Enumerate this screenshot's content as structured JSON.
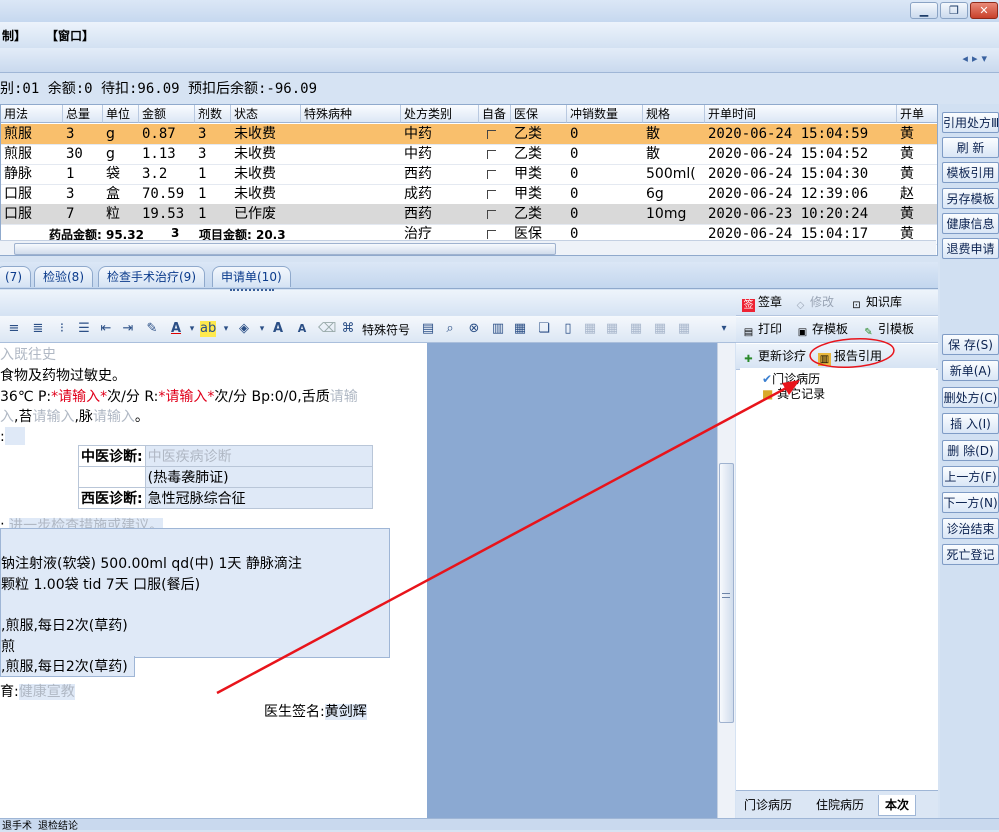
{
  "menu": {
    "items": [
      "制】",
      "【窗口】"
    ]
  },
  "balance_text": "别:01 余额:0 待扣:96.09 预扣后余额:-96.09",
  "grid": {
    "columns": [
      "用法",
      "总量",
      "单位",
      "金额",
      "剂数",
      "状态",
      "特殊病种",
      "处方类别",
      "自备",
      "医保",
      "冲销数量",
      "规格",
      "开单时间",
      "开单"
    ],
    "rows": [
      [
        "煎服",
        "3",
        "g",
        "0.87",
        "3",
        "未收费",
        "",
        "中药",
        "",
        "乙类",
        "0",
        "散",
        "2020-06-24 15:04:59",
        "黄"
      ],
      [
        "煎服",
        "30",
        "g",
        "1.13",
        "3",
        "未收费",
        "",
        "中药",
        "",
        "乙类",
        "0",
        "散",
        "2020-06-24 15:04:52",
        "黄"
      ],
      [
        "静脉",
        "1",
        "袋",
        "3.2",
        "1",
        "未收费",
        "",
        "西药",
        "",
        "甲类",
        "0",
        "500ml(",
        "2020-06-24 15:04:30",
        "黄"
      ],
      [
        "口服",
        "3",
        "盒",
        "70.59",
        "1",
        "未收费",
        "",
        "成药",
        "",
        "甲类",
        "0",
        "6g",
        "2020-06-24 12:39:06",
        "赵"
      ],
      [
        "口服",
        "7",
        "粒",
        "19.53",
        "1",
        "已作废",
        "",
        "西药",
        "",
        "乙类",
        "0",
        "10mg",
        "2020-06-23 10:20:24",
        "黄"
      ],
      [
        "",
        "",
        "",
        "",
        "",
        "",
        "",
        "治疗",
        "",
        "医保",
        "0",
        "",
        "2020-06-24 15:04:17",
        "黄"
      ]
    ],
    "footer_drug_total": "药品金额: 95.32",
    "footer_drug_tail": "3",
    "footer_item_total": "项目金额: 20.3"
  },
  "right_buttons": [
    "引用处方Ⅲ",
    "刷 新",
    "模板引用",
    "另存模板",
    "健康信息",
    "退费申请",
    "保 存(S)",
    "新单(A)",
    "删处方(C)",
    "插 入(I)",
    "删 除(D)",
    "上一方(F)",
    "下一方(N)",
    "诊治结束",
    "死亡登记"
  ],
  "tabs": [
    {
      "label": "(7)"
    },
    {
      "label": "检验(8)"
    },
    {
      "label": "检查手术治疗(9)"
    },
    {
      "label": "申请单(10)"
    }
  ],
  "toolbar": {
    "special_symbol": "特殊符号"
  },
  "editor": {
    "l1_ph": "入既往史",
    "l2": "食物及药物过敏史。",
    "l3_a": "36℃   P:",
    "l3_req1": "*请输入*",
    "l3_b": "次/分 R:",
    "l3_req2": "*请输入*",
    "l3_c": "次/分 Bp:0/0,舌质",
    "l3_ph": "请输",
    "l4_ph1": "入",
    "l4_a": ",苔",
    "l4_ph2": "请输入",
    "l4_b": ",脉",
    "l4_ph3": "请输入",
    "l4_c": "。",
    "l5": ":",
    "tcm_label": "中医诊断:",
    "tcm_value_ph": "中医疾病诊断",
    "tcm_syndrome": "(热毒袭肺证)",
    "wm_label": "西医诊断:",
    "wm_value": "急性冠脉综合征",
    "plan_label": ":",
    "plan_ph": "进一步检查措施或建议。",
    "rx1": "钠注射液(软袋)  500.00ml  qd(中)  1天  静脉滴注",
    "rx2": "颗粒  1.00袋  tid  7天  口服(餐后)",
    "rx3": ",煎服,每日2次(草药)",
    "rx4": "煎",
    "rx5": ",煎服,每日2次(草药)",
    "edu_label": "育:",
    "edu_ph": "健康宣教",
    "sign_label": "医生签名:",
    "sign_name": "黄剑辉"
  },
  "rpanel": {
    "sign": "签章",
    "modify": "修改",
    "knowledge": "知识库",
    "print": "打印",
    "save_template": "存模板",
    "use_template": "引模板",
    "update": "更新诊疗",
    "report": "报告引用"
  },
  "tree": {
    "item1": "门诊病历",
    "item2": "其它记录"
  },
  "bottom_tabs": [
    "门诊病历",
    "住院病历",
    "本次"
  ],
  "status": [
    "退手术",
    "退检结论"
  ],
  "colors": {
    "selected_row": "#f9bf6c",
    "annotation": "#e8141b",
    "gray_row": "#d9d9d9"
  }
}
